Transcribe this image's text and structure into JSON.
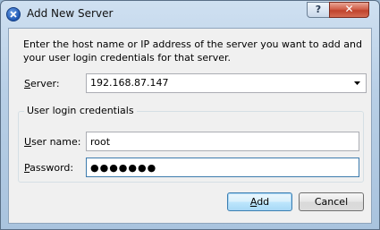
{
  "window": {
    "title": "Add New Server",
    "help_label": "?",
    "close_label": "✕"
  },
  "intro_text": "Enter the host name or IP address of the server you want to add and your user login credentials for that server.",
  "server": {
    "label_mnemonic": "S",
    "label_rest": "erver:",
    "value": "192.168.87.147"
  },
  "credentials": {
    "group_title": "User login credentials",
    "username_mnemonic": "U",
    "username_rest": "ser name:",
    "username_value": "root",
    "password_mnemonic": "P",
    "password_rest": "assword:",
    "password_value": "●●●●●●●"
  },
  "buttons": {
    "add_mnemonic": "A",
    "add_rest": "dd",
    "cancel_label": "Cancel"
  }
}
